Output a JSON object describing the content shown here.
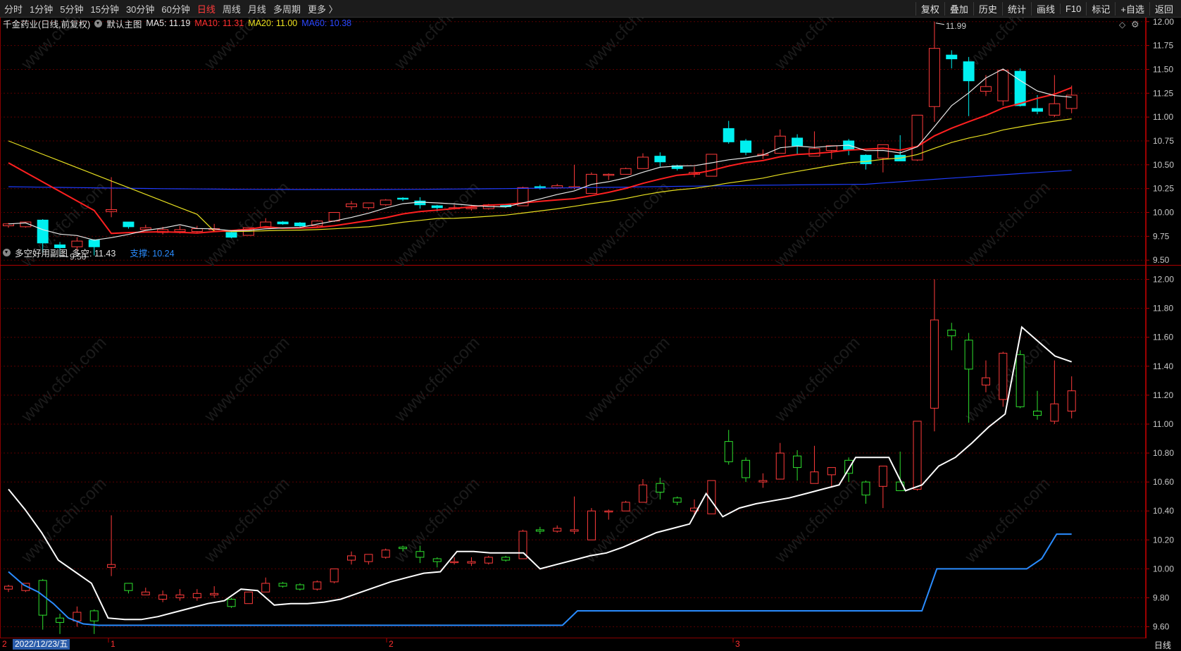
{
  "toolbar": {
    "periods": [
      "分时",
      "1分钟",
      "5分钟",
      "15分钟",
      "30分钟",
      "60分钟",
      "日线",
      "周线",
      "月线",
      "多周期",
      "更多 〉"
    ],
    "active": "日线",
    "right_items": [
      "复权",
      "叠加",
      "历史",
      "统计",
      "画线",
      "F10",
      "标记",
      "+自选",
      "返回"
    ]
  },
  "main_legend": {
    "title": "千金药业(日线,前复权)",
    "indicator": "默认主图",
    "ma5": "MA5: 11.19",
    "ma10": "MA10: 11.31",
    "ma20": "MA20: 11.00",
    "ma60": "MA60: 10.38"
  },
  "sub_legend": {
    "indicator": "多空好用副图",
    "duokong": "多空: 11.43",
    "zhicheng": "支撑: 10.24"
  },
  "bottom": {
    "date": "2022/12/23/五",
    "month_marks": [
      "1",
      "2",
      "3"
    ],
    "period": "日线",
    "left_mark": "2"
  },
  "watermark": "www.cfchi.com",
  "colors": {
    "up": "#ff3b3b",
    "down_main": "#00f0f0",
    "down_sub": "#2ee02e",
    "ma5": "#e8e8e8",
    "ma10": "#ff2020",
    "ma20": "#e8e020",
    "ma60": "#1e3cff",
    "duokong": "#ffffff",
    "zhicheng": "#2a8cff",
    "grid": "#5a0000"
  },
  "chart_data": {
    "type": "candlestick",
    "main": {
      "y_ticks": [
        "12.00",
        "11.75",
        "11.50",
        "11.25",
        "11.00",
        "10.75",
        "10.50",
        "10.25",
        "10.00",
        "9.75",
        "9.50"
      ],
      "ylim": [
        9.45,
        12.05
      ],
      "max_label": "11.99",
      "min_label": "9.50",
      "candles": [
        [
          9.86,
          9.89,
          9.84,
          9.88
        ],
        [
          9.85,
          9.9,
          9.84,
          9.9
        ],
        [
          9.92,
          9.93,
          9.58,
          9.68
        ],
        [
          9.66,
          9.69,
          9.55,
          9.63
        ],
        [
          9.64,
          9.74,
          9.6,
          9.7
        ],
        [
          9.71,
          9.72,
          9.55,
          9.64
        ],
        [
          10.01,
          10.37,
          9.95,
          10.03
        ],
        [
          9.9,
          9.9,
          9.83,
          9.85
        ],
        [
          9.82,
          9.87,
          9.82,
          9.84
        ],
        [
          9.79,
          9.85,
          9.77,
          9.82
        ],
        [
          9.8,
          9.86,
          9.78,
          9.82
        ],
        [
          9.8,
          9.86,
          9.78,
          9.83
        ],
        [
          9.82,
          9.88,
          9.8,
          9.83
        ],
        [
          9.79,
          9.8,
          9.73,
          9.74
        ],
        [
          9.76,
          9.84,
          9.76,
          9.84
        ],
        [
          9.84,
          9.94,
          9.84,
          9.9
        ],
        [
          9.9,
          9.91,
          9.87,
          9.88
        ],
        [
          9.89,
          9.9,
          9.85,
          9.86
        ],
        [
          9.86,
          9.92,
          9.85,
          9.91
        ],
        [
          9.91,
          10.0,
          9.9,
          10.0
        ],
        [
          10.06,
          10.12,
          10.03,
          10.09
        ],
        [
          10.05,
          10.1,
          10.03,
          10.1
        ],
        [
          10.08,
          10.14,
          10.07,
          10.13
        ],
        [
          10.15,
          10.16,
          10.12,
          10.14
        ],
        [
          10.12,
          10.16,
          10.04,
          10.08
        ],
        [
          10.07,
          10.08,
          10.01,
          10.05
        ],
        [
          10.05,
          10.08,
          10.03,
          10.05
        ],
        [
          10.04,
          10.08,
          10.02,
          10.05
        ],
        [
          10.04,
          10.09,
          10.03,
          10.08
        ],
        [
          10.08,
          10.09,
          10.05,
          10.06
        ],
        [
          10.07,
          10.27,
          10.07,
          10.26
        ],
        [
          10.27,
          10.29,
          10.24,
          10.26
        ],
        [
          10.26,
          10.3,
          10.25,
          10.28
        ],
        [
          10.26,
          10.5,
          10.24,
          10.27
        ],
        [
          10.2,
          10.42,
          10.2,
          10.4
        ],
        [
          10.4,
          10.41,
          10.34,
          10.4
        ],
        [
          10.4,
          10.47,
          10.4,
          10.46
        ],
        [
          10.46,
          10.62,
          10.46,
          10.58
        ],
        [
          10.59,
          10.63,
          10.48,
          10.53
        ],
        [
          10.49,
          10.5,
          10.44,
          10.46
        ],
        [
          10.4,
          10.48,
          10.37,
          10.42
        ],
        [
          10.38,
          10.61,
          10.38,
          10.61
        ],
        [
          10.88,
          10.96,
          10.72,
          10.74
        ],
        [
          10.75,
          10.77,
          10.6,
          10.63
        ],
        [
          10.6,
          10.66,
          10.56,
          10.61
        ],
        [
          10.62,
          10.87,
          10.62,
          10.8
        ],
        [
          10.78,
          10.82,
          10.61,
          10.7
        ],
        [
          10.59,
          10.85,
          10.59,
          10.67
        ],
        [
          10.65,
          10.7,
          10.56,
          10.7
        ],
        [
          10.75,
          10.77,
          10.6,
          10.66
        ],
        [
          10.6,
          10.61,
          10.45,
          10.51
        ],
        [
          10.57,
          10.61,
          10.42,
          10.71
        ],
        [
          10.6,
          10.81,
          10.57,
          10.54
        ],
        [
          10.55,
          11.02,
          10.54,
          11.02
        ],
        [
          11.11,
          12.0,
          10.95,
          11.72
        ],
        [
          11.65,
          11.7,
          11.51,
          11.61
        ],
        [
          11.58,
          11.63,
          11.01,
          11.38
        ],
        [
          11.27,
          11.44,
          11.22,
          11.32
        ],
        [
          11.17,
          11.5,
          11.12,
          11.49
        ],
        [
          11.48,
          11.51,
          11.11,
          11.12
        ],
        [
          11.09,
          11.23,
          11.03,
          11.06
        ],
        [
          11.02,
          11.44,
          11.0,
          11.14
        ],
        [
          11.09,
          11.33,
          11.04,
          11.23
        ]
      ]
    },
    "sub": {
      "y_ticks": [
        "12.00",
        "11.80",
        "11.60",
        "11.40",
        "11.20",
        "11.00",
        "10.80",
        "10.60",
        "10.40",
        "10.20",
        "10.00",
        "9.80",
        "9.60"
      ],
      "ylim": [
        9.52,
        12.1
      ],
      "duokong": [
        10.55,
        10.41,
        10.25,
        10.06,
        9.98,
        9.9,
        9.66,
        9.65,
        9.65,
        9.67,
        9.7,
        9.73,
        9.76,
        9.78,
        9.86,
        9.85,
        9.75,
        9.76,
        9.76,
        9.77,
        9.79,
        9.83,
        9.87,
        9.91,
        9.94,
        9.97,
        9.98,
        10.12,
        10.12,
        10.11,
        10.11,
        10.11,
        10.0,
        10.03,
        10.06,
        10.09,
        10.11,
        10.15,
        10.2,
        10.25,
        10.28,
        10.31,
        10.52,
        10.36,
        10.42,
        10.45,
        10.47,
        10.49,
        10.52,
        10.55,
        10.58,
        10.77,
        10.77,
        10.77,
        10.54,
        10.58,
        10.71,
        10.77,
        10.87,
        10.98,
        11.07,
        11.67,
        11.57,
        11.47,
        11.43
      ],
      "zhicheng": [
        9.98,
        9.89,
        9.84,
        9.76,
        9.66,
        9.62,
        9.61,
        9.61,
        9.61,
        9.61,
        9.61,
        9.61,
        9.61,
        9.61,
        9.61,
        9.61,
        9.61,
        9.61,
        9.61,
        9.61,
        9.61,
        9.61,
        9.61,
        9.61,
        9.61,
        9.61,
        9.61,
        9.61,
        9.61,
        9.61,
        9.61,
        9.61,
        9.61,
        9.61,
        9.61,
        9.61,
        9.61,
        9.61,
        9.71,
        9.71,
        9.71,
        9.71,
        9.71,
        9.71,
        9.71,
        9.71,
        9.71,
        9.71,
        9.71,
        9.71,
        9.71,
        9.71,
        9.71,
        9.71,
        9.71,
        9.71,
        9.71,
        9.71,
        9.71,
        9.71,
        9.71,
        9.71,
        10.0,
        10.0,
        10.0,
        10.0,
        10.0,
        10.0,
        10.0,
        10.07,
        10.24,
        10.24
      ]
    }
  }
}
